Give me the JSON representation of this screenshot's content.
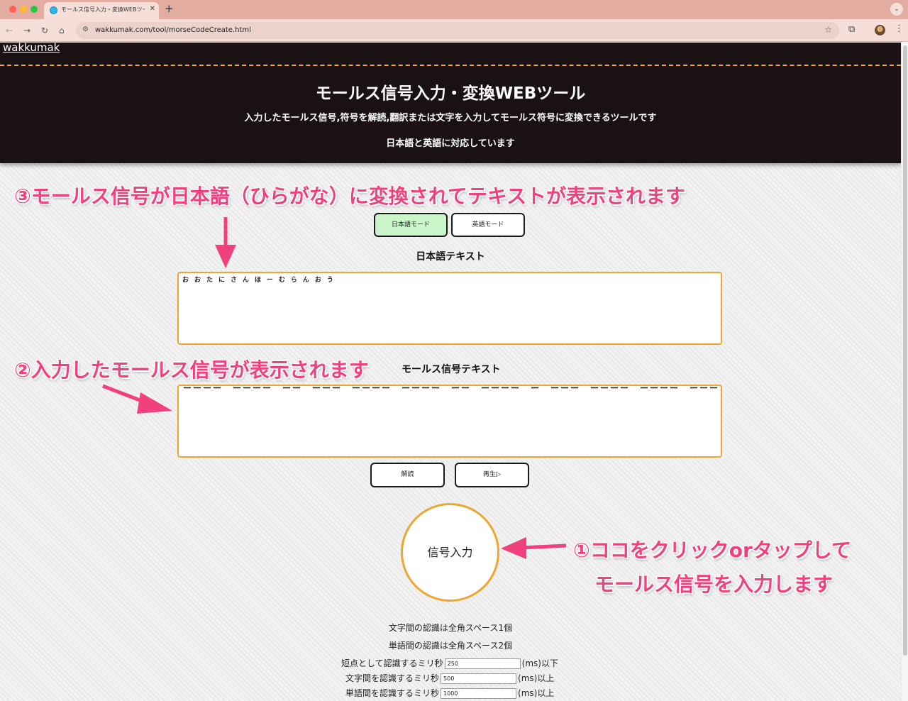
{
  "browser": {
    "tab_title": "モールス信号入力・変換WEBツール",
    "url": "wakkumak.com/tool/morseCodeCreate.html",
    "new_tab": "+",
    "tab_close": "✕"
  },
  "header": {
    "logo": "wakkumak",
    "title": "モールス信号入力・変換WEBツール",
    "description": "入力したモールス信号,符号を解読,翻訳または文字を入力してモールス符号に変換できるツールです",
    "languages": "日本語と英語に対応しています"
  },
  "annotations": {
    "step3": "③モールス信号が日本語（ひらがな）に変換されてテキストが表示されます",
    "step2": "②入力したモールス信号が表示されます",
    "step1_line1": "①ココをクリックorタップして",
    "step1_line2": "モールス信号を入力します"
  },
  "modes": {
    "japanese": "日本語モード",
    "english": "英語モード"
  },
  "japanese_text": {
    "label": "日本語テキスト",
    "value": "おおたにさんほーむらんおう"
  },
  "morse_text": {
    "label": "モールス信号テキスト",
    "value": "ーーーー　ーーーー　ーー　ーーー　ーーーー　ーーーー　ーー　ーーーー　ー　ーーー　ーーーー　ーーーー　ーーー"
  },
  "actions": {
    "decode": "解読",
    "play": "再生▷"
  },
  "signal_button": "信号入力",
  "notes": {
    "char_gap": "文字間の認識は全角スペース1個",
    "word_gap": "単語間の認識は全角スペース2個"
  },
  "settings": {
    "short": {
      "label": "短点として認識するミリ秒",
      "value": "250",
      "unit": "(ms)以下"
    },
    "char": {
      "label": "文字間を認識するミリ秒",
      "value": "500",
      "unit": "(ms)以上"
    },
    "word": {
      "label": "単語間を認識するミリ秒",
      "value": "1000",
      "unit": "(ms)以上"
    }
  },
  "colors": {
    "accent_orange": "#efa531",
    "annotation_pink": "#f0407d",
    "header_bg": "#1a1212",
    "active_mode": "#c9f5c9"
  }
}
